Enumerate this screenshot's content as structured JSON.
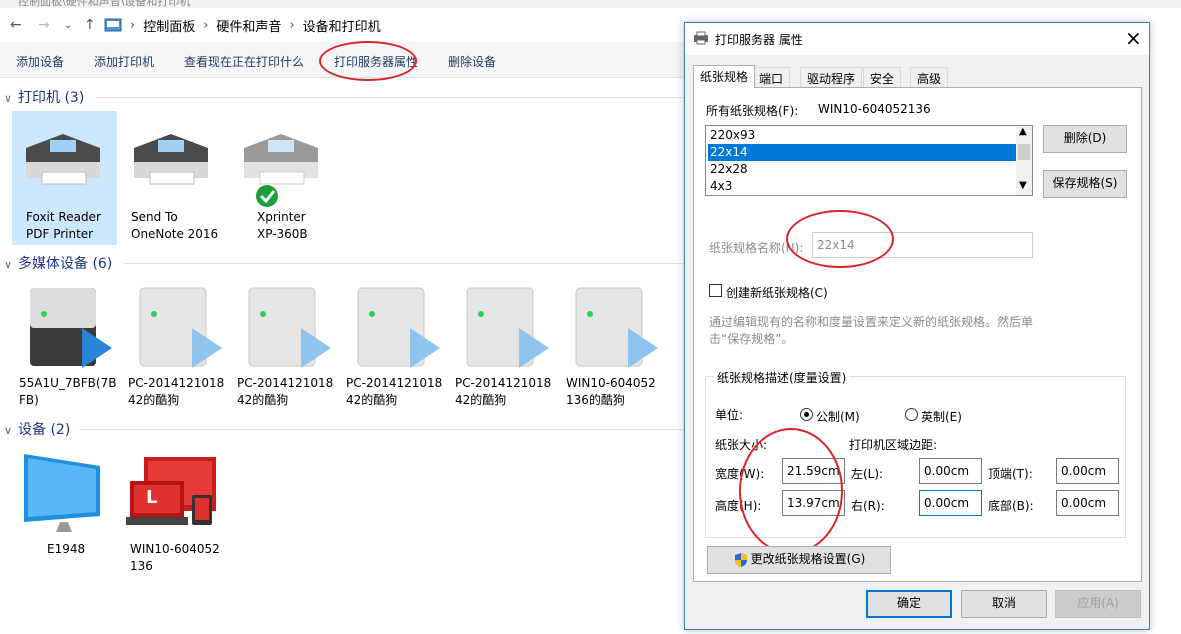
{
  "explorer": {
    "window_title": "控制面板\\硬件和声音\\设备和打印机",
    "breadcrumb": [
      "控制面板",
      "硬件和声音",
      "设备和打印机"
    ],
    "toolbar": [
      "添加设备",
      "添加打印机",
      "查看现在正在打印什么",
      "打印服务器属性",
      "删除设备"
    ],
    "groups": {
      "printers": "打印机 (3)",
      "media": "多媒体设备 (6)",
      "devices": "设备 (2)"
    },
    "printers": [
      "Foxit Reader\nPDF Printer",
      "Send To\nOneNote 2016",
      "Xprinter\nXP-360B"
    ],
    "media": [
      "55A1U_7BFB(7B\nFB)",
      "PC-2014121018\n42的酷狗",
      "PC-2014121018\n42的酷狗",
      "PC-2014121018\n42的酷狗",
      "PC-2014121018\n42的酷狗",
      "WIN10-604052\n136的酷狗"
    ],
    "devices": [
      "E1948",
      "WIN10-604052\n136"
    ],
    "monitor_label": "L"
  },
  "dialog": {
    "title": "打印服务器 属性",
    "tabs": [
      "纸张规格",
      "端口",
      "驱动程序",
      "安全",
      "高级"
    ],
    "all_forms_label": "所有纸张规格(F):",
    "server_name": "WIN10-604052136",
    "forms": [
      "220x93",
      "22x14",
      "22x28",
      "4x3"
    ],
    "selected_form": "22x14",
    "delete_btn": "删除(D)",
    "save_btn": "保存规格(S)",
    "form_name_label": "纸张规格名称(N):",
    "form_name_value": "22x14",
    "create_new": "创建新纸张规格(C)",
    "hint": "通过编辑现有的名称和度量设置来定义新的纸张规格。然后单击“保存规格”。",
    "desc_group": "纸张规格描述(度量设置)",
    "units_label": "单位:",
    "metric": "公制(M)",
    "english": "英制(E)",
    "paper_size": "纸张大小:",
    "margins": "打印机区域边距:",
    "width_label": "宽度(W):",
    "width_value": "21.59cm",
    "height_label": "高度(H):",
    "height_value": "13.97cm",
    "left_label": "左(L):",
    "left_value": "0.00cm",
    "right_label": "右(R):",
    "right_value": "0.00cm",
    "top_label": "顶端(T):",
    "top_value": "0.00cm",
    "bottom_label": "底部(B):",
    "bottom_value": "0.00cm",
    "change_settings": "更改纸张规格设置(G)",
    "ok": "确定",
    "cancel": "取消",
    "apply": "应用(A)",
    "close": "×"
  }
}
